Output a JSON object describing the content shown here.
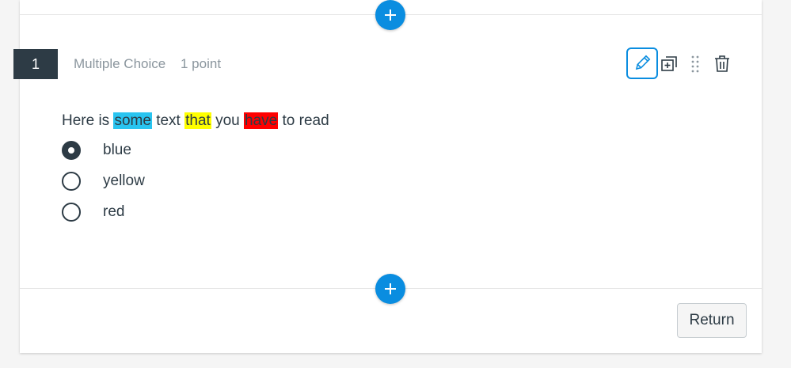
{
  "question": {
    "number": "1",
    "type": "Multiple Choice",
    "points": "1 point",
    "text_parts": [
      {
        "text": "Here is ",
        "highlight": null
      },
      {
        "text": "some",
        "highlight": "#29c4f0"
      },
      {
        "text": " text ",
        "highlight": null
      },
      {
        "text": "that",
        "highlight": "#ffff00"
      },
      {
        "text": " you ",
        "highlight": null
      },
      {
        "text": "have",
        "highlight": "#ff0000"
      },
      {
        "text": " to read",
        "highlight": null
      }
    ],
    "options": [
      {
        "label": "blue",
        "selected": true
      },
      {
        "label": "yellow",
        "selected": false
      },
      {
        "label": "red",
        "selected": false
      }
    ]
  },
  "toolbar": {
    "icons": [
      "pencil-icon",
      "duplicate-icon",
      "drag-handle-icon",
      "trash-icon"
    ]
  },
  "footer": {
    "return_label": "Return"
  },
  "colors": {
    "accent": "#0a8de0",
    "question_badge": "#2d3b45",
    "muted_text": "#8b969e"
  }
}
